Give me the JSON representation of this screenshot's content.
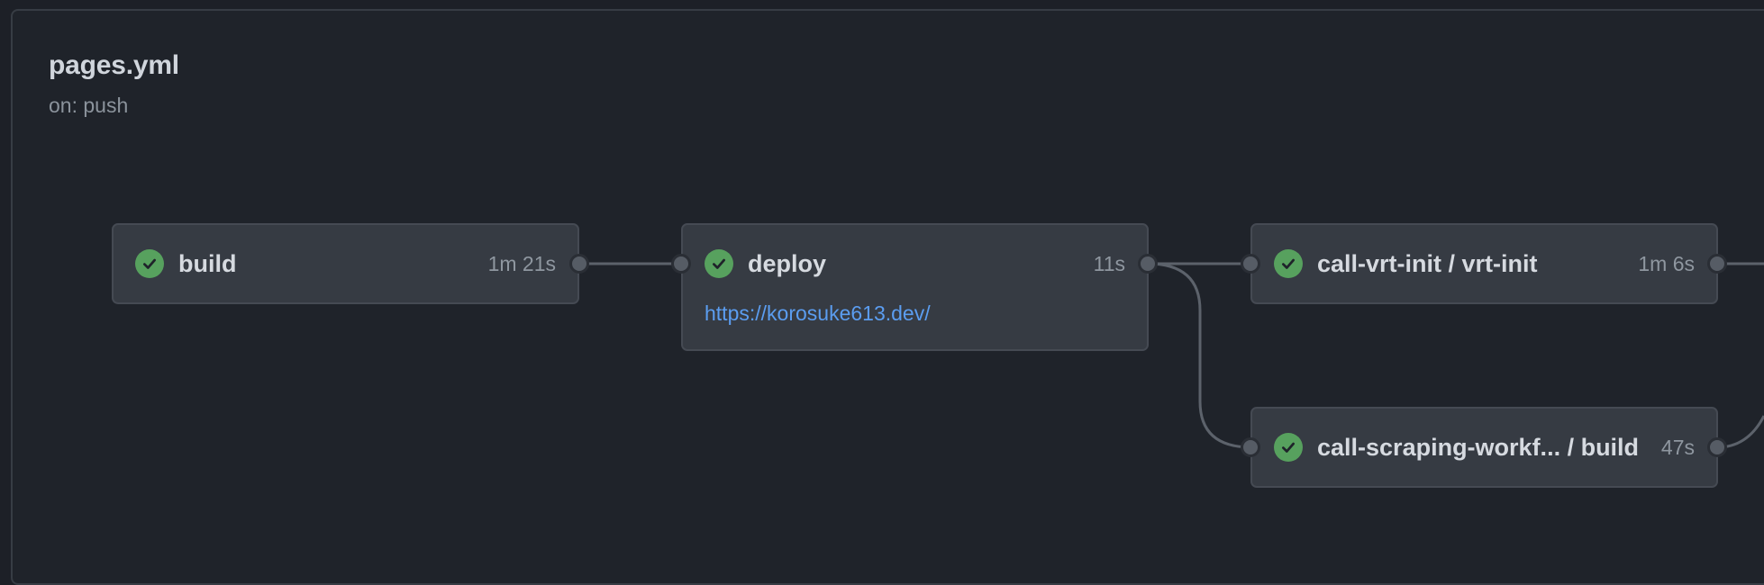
{
  "workflow": {
    "title": "pages.yml",
    "trigger": "on: push"
  },
  "jobs": [
    {
      "name": "build",
      "duration": "1m 21s",
      "status": "success"
    },
    {
      "name": "deploy",
      "duration": "11s",
      "status": "success",
      "link": "https://korosuke613.dev/"
    },
    {
      "name": "call-vrt-init / vrt-init",
      "duration": "1m 6s",
      "status": "success"
    },
    {
      "name": "call-scraping-workf... / build",
      "duration": "47s",
      "status": "success"
    }
  ],
  "colors": {
    "success": "#57a15e",
    "link": "#5b9df0",
    "background": "#1d2027",
    "card": "#363b43",
    "connector": "#5c626b"
  },
  "icons": {
    "status_success": "check-circle-icon"
  }
}
